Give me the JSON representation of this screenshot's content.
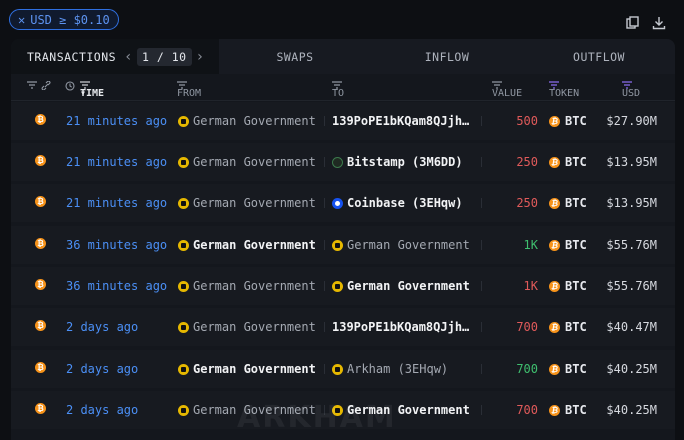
{
  "filter": {
    "close_glyph": "✕",
    "label": "USD ≥ $0.10"
  },
  "icons": {
    "copy": "copy-icon",
    "download": "download-icon"
  },
  "tabs": {
    "transactions": "TRANSACTIONS",
    "page": "1 / 10",
    "swaps": "SWAPS",
    "inflow": "INFLOW",
    "outflow": "OUTFLOW"
  },
  "columns": {
    "time": "TIME",
    "from": "FROM",
    "to": "TO",
    "value": "VALUE",
    "token": "TOKEN",
    "usd": "USD"
  },
  "rows": [
    {
      "time": "21 minutes ago",
      "from": "German Government",
      "to": "139PoPE1bKQam8QJjh…",
      "value": "500",
      "token": "BTC",
      "usd": "$27.90M"
    },
    {
      "time": "21 minutes ago",
      "from": "German Government",
      "to": "Bitstamp (3M6DD)",
      "value": "250",
      "token": "BTC",
      "usd": "$13.95M"
    },
    {
      "time": "21 minutes ago",
      "from": "German Government",
      "to": "Coinbase (3EHqw)",
      "value": "250",
      "token": "BTC",
      "usd": "$13.95M"
    },
    {
      "time": "36 minutes ago",
      "from": "German Government",
      "to": "German Government",
      "value": "1K",
      "token": "BTC",
      "usd": "$55.76M"
    },
    {
      "time": "36 minutes ago",
      "from": "German Government",
      "to": "German Government",
      "value": "1K",
      "token": "BTC",
      "usd": "$55.76M"
    },
    {
      "time": "2 days ago",
      "from": "German Government",
      "to": "139PoPE1bKQam8QJjh…",
      "value": "700",
      "token": "BTC",
      "usd": "$40.47M"
    },
    {
      "time": "2 days ago",
      "from": "German Government",
      "to": "Arkham (3EHqw)",
      "value": "700",
      "token": "BTC",
      "usd": "$40.25M"
    },
    {
      "time": "2 days ago",
      "from": "German Government",
      "to": "German Government",
      "value": "700",
      "token": "BTC",
      "usd": "$40.25M"
    }
  ],
  "watermark": "ARKHAM",
  "colors": {
    "accent": "#4b8ff5",
    "out_value": "#e05a5a",
    "in_value": "#3fbf6f",
    "btc": "#f7931a"
  }
}
